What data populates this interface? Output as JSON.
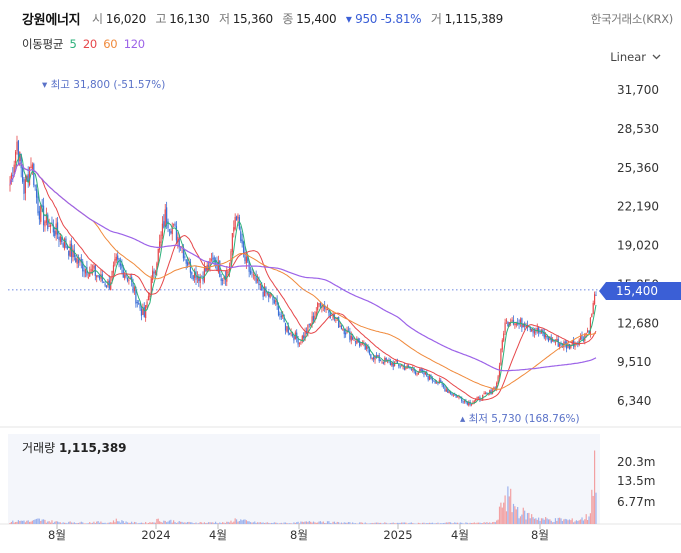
{
  "stock": {
    "name": "강원에너지",
    "open_label": "시",
    "open": "16,020",
    "high_label": "고",
    "high": "16,130",
    "low_label": "저",
    "low": "15,360",
    "close_label": "종",
    "close": "15,400",
    "change": "▾ 950 -5.81%",
    "volume_label": "거",
    "volume": "1,115,389",
    "exchange": "한국거래소(KRX)"
  },
  "ma_legend": {
    "title": "이동평균",
    "items": [
      {
        "label": "5",
        "color": "#2bb07a"
      },
      {
        "label": "20",
        "color": "#e6474a"
      },
      {
        "label": "60",
        "color": "#f08a3c"
      },
      {
        "label": "120",
        "color": "#9c63e8"
      }
    ]
  },
  "scale": {
    "label": "Linear"
  },
  "volume_panel": {
    "label": "거래량",
    "value": "1,115,389"
  },
  "chart_data": {
    "type": "candlestick",
    "price_axis": {
      "ticks": [
        "31,700",
        "28,530",
        "25,360",
        "22,190",
        "19,020",
        "15,850",
        "12,680",
        "9,510",
        "6,340"
      ],
      "range": [
        6340,
        31700
      ]
    },
    "volume_axis": {
      "ticks": [
        "20.3m",
        "13.5m",
        "6.77m"
      ]
    },
    "x_ticks": [
      "8월",
      "2024",
      "4월",
      "8월",
      "2025",
      "4월",
      "8월"
    ],
    "current_price": "15,400",
    "annotations": {
      "high": "최고 31,800 (-51.57%)",
      "low": "최저 5,730 (168.76%)"
    },
    "close_series": [
      24000,
      27500,
      23500,
      26000,
      22000,
      21000,
      20500,
      19800,
      19000,
      18200,
      17500,
      17000,
      16800,
      16200,
      15800,
      17600,
      17000,
      16200,
      14500,
      13200,
      16000,
      18500,
      21500,
      20500,
      19500,
      17800,
      16800,
      16500,
      17200,
      18000,
      16500,
      17000,
      22000,
      18200,
      16800,
      15800,
      15200,
      14800,
      13800,
      12400,
      11800,
      11200,
      12000,
      13200,
      14500,
      13800,
      13000,
      12400,
      11800,
      11300,
      10800,
      10200,
      9800,
      9600,
      9400,
      9300,
      9100,
      8900,
      8700,
      8400,
      8100,
      7700,
      7200,
      6800,
      6500,
      6200,
      6400,
      6700,
      7000,
      7800,
      12500,
      13200,
      12500,
      12800,
      12300,
      11900,
      11500,
      11200,
      11000,
      10800,
      11200,
      11500,
      12200,
      15400
    ],
    "volume_series": [
      0.6,
      0.9,
      1.1,
      0.7,
      1.4,
      1.0,
      0.8,
      0.6,
      0.5,
      0.6,
      0.5,
      0.4,
      0.7,
      0.5,
      0.4,
      1.2,
      0.8,
      0.5,
      0.4,
      0.4,
      0.5,
      1.3,
      0.9,
      1.0,
      0.6,
      0.5,
      0.4,
      0.5,
      0.4,
      0.6,
      0.4,
      0.5,
      1.5,
      1.1,
      0.6,
      0.5,
      0.4,
      0.4,
      0.3,
      0.4,
      0.3,
      0.5,
      0.6,
      0.8,
      0.9,
      0.6,
      0.5,
      0.4,
      0.4,
      0.3,
      0.4,
      0.3,
      0.3,
      0.4,
      0.3,
      0.3,
      0.4,
      0.3,
      0.3,
      0.3,
      0.3,
      0.3,
      0.4,
      0.4,
      0.3,
      0.4,
      0.3,
      0.4,
      0.4,
      0.8,
      9.5,
      7.0,
      4.5,
      3.0,
      2.5,
      1.8,
      1.5,
      1.2,
      1.5,
      1.3,
      1.1,
      1.6,
      2.5,
      20.3
    ]
  }
}
